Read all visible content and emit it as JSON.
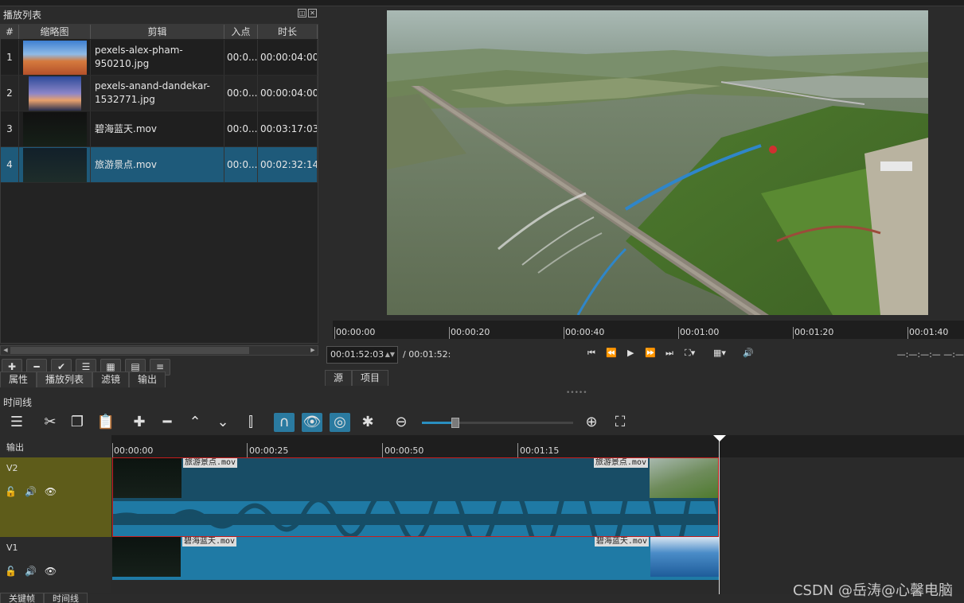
{
  "playlist": {
    "title": "播放列表",
    "columns": [
      "#",
      "缩略图",
      "剪辑",
      "入点",
      "时长"
    ],
    "rows": [
      {
        "num": "1",
        "clip": "pexels-alex-pham-950210.jpg",
        "in": "00:0...",
        "duration": "00:00:04:00"
      },
      {
        "num": "2",
        "clip": "pexels-anand-dandekar-1532771.jpg",
        "in": "00:0...",
        "duration": "00:00:04:00"
      },
      {
        "num": "3",
        "clip": "碧海蓝天.mov",
        "in": "00:0...",
        "duration": "00:03:17:03"
      },
      {
        "num": "4",
        "clip": "旅游景点.mov",
        "in": "00:0...",
        "duration": "00:02:32:14"
      }
    ],
    "selected_row": 4,
    "toolbar_icons": [
      "add-icon",
      "remove-icon",
      "check-icon",
      "list-view-icon",
      "grid-view-icon",
      "detail-view-icon",
      "menu-icon"
    ]
  },
  "left_tabs": [
    "属性",
    "播放列表",
    "滤镜",
    "输出"
  ],
  "viewer": {
    "ruler_labels": [
      "00:00:00",
      "00:00:20",
      "00:00:40",
      "00:01:00",
      "00:01:20",
      "00:01:40"
    ],
    "timecode": "00:01:52:03",
    "total": "/ 00:01:52:",
    "right_timecode": "—:—:—:— —:—",
    "tabs": [
      "源",
      "项目"
    ]
  },
  "timeline": {
    "title": "时间线",
    "output_label": "输出",
    "ruler_labels": [
      "00:00:00",
      "00:00:25",
      "00:00:50",
      "00:01:15"
    ],
    "tracks": [
      {
        "name": "V2",
        "clip_label_start": "旅游景点.mov",
        "clip_label_end": "旅游景点.mov"
      },
      {
        "name": "V1",
        "clip_label_start": "碧海蓝天.mov",
        "clip_label_end": "碧海蓝天.mov"
      }
    ],
    "zoom_level": 0.2
  },
  "bottom_tabs": [
    "关键帧",
    "时间线"
  ],
  "watermark": "CSDN @岳涛@心馨电脑",
  "colors": {
    "selected": "#1e5a7a",
    "accent": "#2a7aa0",
    "clip": "#1f7aa5",
    "v2_track": "#5e5c1a",
    "clip_border": "#c81c1c"
  }
}
